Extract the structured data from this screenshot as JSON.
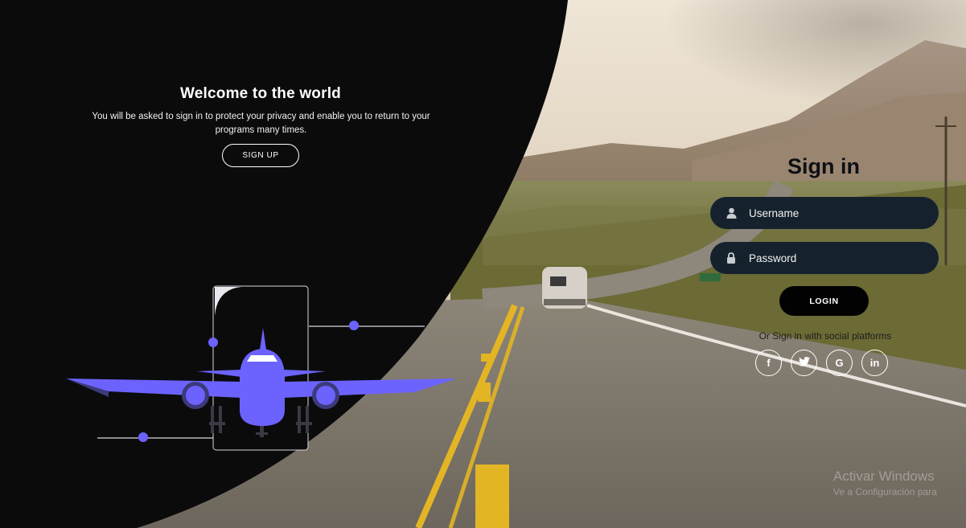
{
  "left_panel": {
    "title": "Welcome to the world",
    "description": "You will be asked to sign in to protect your privacy and enable you to return to your programs many times.",
    "signup_label": "SIGN UP"
  },
  "signin": {
    "title": "Sign in",
    "username_placeholder": "Username",
    "password_placeholder": "Password",
    "login_label": "LOGIN",
    "social_text": "Or Sign in with social platforms"
  },
  "social": [
    {
      "icon": "facebook-icon",
      "glyph": "f"
    },
    {
      "icon": "twitter-icon",
      "glyph": "🐦"
    },
    {
      "icon": "google-icon",
      "glyph": "G"
    },
    {
      "icon": "linkedin-icon",
      "glyph": "in"
    }
  ],
  "watermark": {
    "line1": "Activar Windows",
    "line2": "Ve a Configuración para"
  },
  "colors": {
    "accent": "#6c63ff",
    "panel": "#0b0b0c",
    "input_bg": "#15222d"
  }
}
